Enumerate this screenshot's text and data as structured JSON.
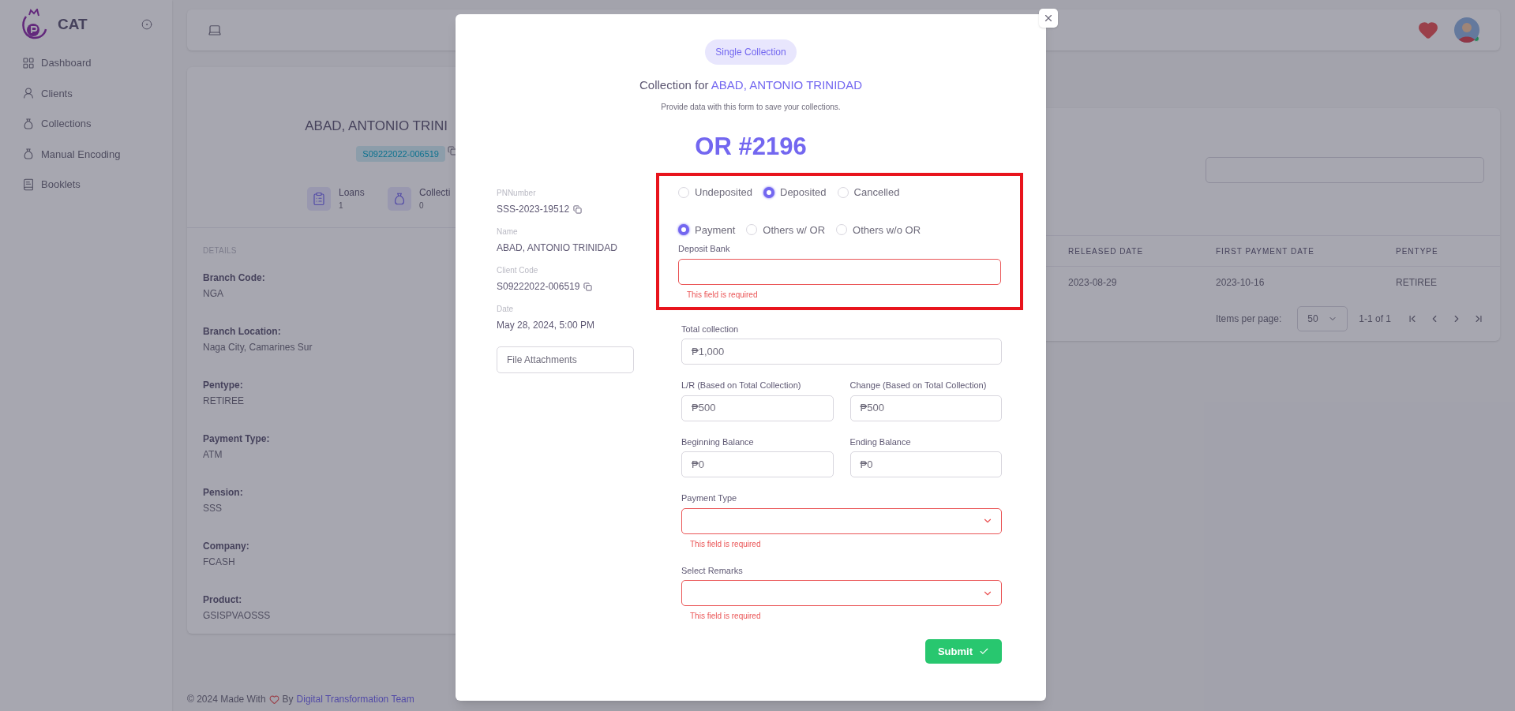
{
  "sidebar": {
    "brand": "CAT",
    "items": [
      {
        "label": "Dashboard"
      },
      {
        "label": "Clients"
      },
      {
        "label": "Collections"
      },
      {
        "label": "Manual Encoding"
      },
      {
        "label": "Booklets"
      }
    ]
  },
  "client_card": {
    "name": "ABAD, ANTONIO TRINI",
    "code": "S09222022-006519",
    "stats": [
      {
        "label": "Loans",
        "value": "1"
      },
      {
        "label": "Collecti",
        "value": "0"
      }
    ],
    "details_heading": "DETAILS",
    "details": [
      {
        "label": "Branch Code:",
        "value": "NGA"
      },
      {
        "label": "Branch Location:",
        "value": "Naga City, Camarines Sur"
      },
      {
        "label": "Pentype:",
        "value": "RETIREE"
      },
      {
        "label": "Payment Type:",
        "value": "ATM"
      },
      {
        "label": "Pension:",
        "value": "SSS"
      },
      {
        "label": "Company:",
        "value": "FCASH"
      },
      {
        "label": "Product:",
        "value": "GSISPVAOSSS"
      }
    ]
  },
  "loans_table": {
    "columns": [
      "RELEASED DATE",
      "FIRST PAYMENT DATE",
      "PENTYPE"
    ],
    "rows": [
      [
        "2023-08-29",
        "2023-10-16",
        "RETIREE"
      ]
    ],
    "items_per_page_label": "Items per page:",
    "items_per_page": "50",
    "range": "1-1 of 1"
  },
  "footer": {
    "prefix": "© 2024 Made With",
    "by": "By",
    "link": "Digital Transformation Team"
  },
  "modal": {
    "badge": "Single Collection",
    "title_prefix": "Collection for",
    "title_name": "ABAD, ANTONIO TRINIDAD",
    "subtitle": "Provide data with this form to save your collections.",
    "or_number": "OR #2196",
    "info": [
      {
        "label": "PNNumber",
        "value": "SSS-2023-19512",
        "copyable": true
      },
      {
        "label": "Name",
        "value": "ABAD, ANTONIO TRINIDAD",
        "copyable": false
      },
      {
        "label": "Client Code",
        "value": "S09222022-006519",
        "copyable": true
      },
      {
        "label": "Date",
        "value": "May 28, 2024, 5:00 PM",
        "copyable": false
      }
    ],
    "file_button": "File Attachments",
    "status_options": [
      {
        "label": "Undeposited",
        "selected": false
      },
      {
        "label": "Deposited",
        "selected": true
      },
      {
        "label": "Cancelled",
        "selected": false
      }
    ],
    "type_options": [
      {
        "label": "Payment",
        "selected": true
      },
      {
        "label": "Others w/ OR",
        "selected": false
      },
      {
        "label": "Others w/o OR",
        "selected": false
      }
    ],
    "deposit_bank": {
      "label": "Deposit Bank",
      "error": "This field is required",
      "invalid": true
    },
    "field_rows": [
      [
        {
          "kind": "text",
          "label": "Total collection",
          "value": "₱1,000",
          "invalid": false
        }
      ],
      [
        {
          "kind": "text",
          "label": "L/R (Based on Total Collection)",
          "value": "₱500",
          "invalid": false
        },
        {
          "kind": "text",
          "label": "Change (Based on Total Collection)",
          "value": "₱500",
          "invalid": false
        }
      ],
      [
        {
          "kind": "text",
          "label": "Beginning Balance",
          "value": "₱0",
          "invalid": false
        },
        {
          "kind": "text",
          "label": "Ending Balance",
          "value": "₱0",
          "invalid": false
        }
      ],
      [
        {
          "kind": "select",
          "label": "Payment Type",
          "error": "This field is required",
          "invalid": true
        }
      ],
      [
        {
          "kind": "select",
          "label": "Select Remarks",
          "error": "This field is required",
          "invalid": true
        }
      ]
    ],
    "submit": "Submit"
  }
}
